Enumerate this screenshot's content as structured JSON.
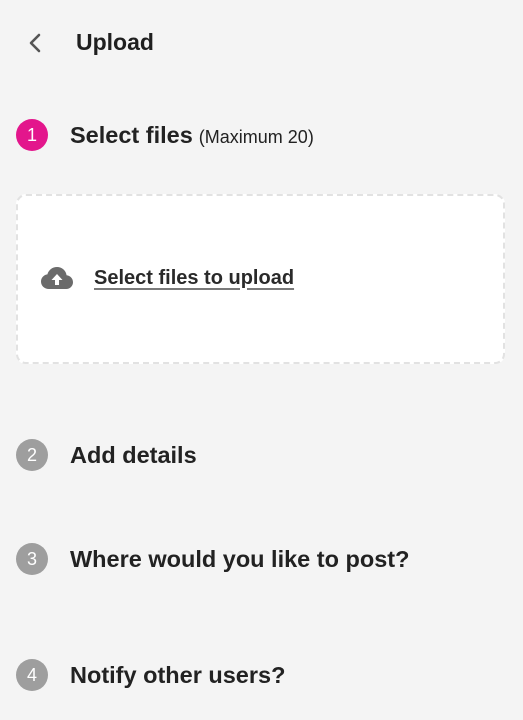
{
  "header": {
    "title": "Upload",
    "back_icon": "chevron-left-icon"
  },
  "colors": {
    "active_step": "#e3168c",
    "inactive_step": "#9e9e9e",
    "background": "#f4f4f4"
  },
  "steps": [
    {
      "number": "1",
      "title": "Select files",
      "subtitle": "(Maximum 20)",
      "active": true
    },
    {
      "number": "2",
      "title": "Add details",
      "active": false
    },
    {
      "number": "3",
      "title": "Where would you like to post?",
      "active": false
    },
    {
      "number": "4",
      "title": "Notify other users?",
      "active": false
    }
  ],
  "dropzone": {
    "icon": "cloud-upload-icon",
    "label": "Select files to upload"
  }
}
